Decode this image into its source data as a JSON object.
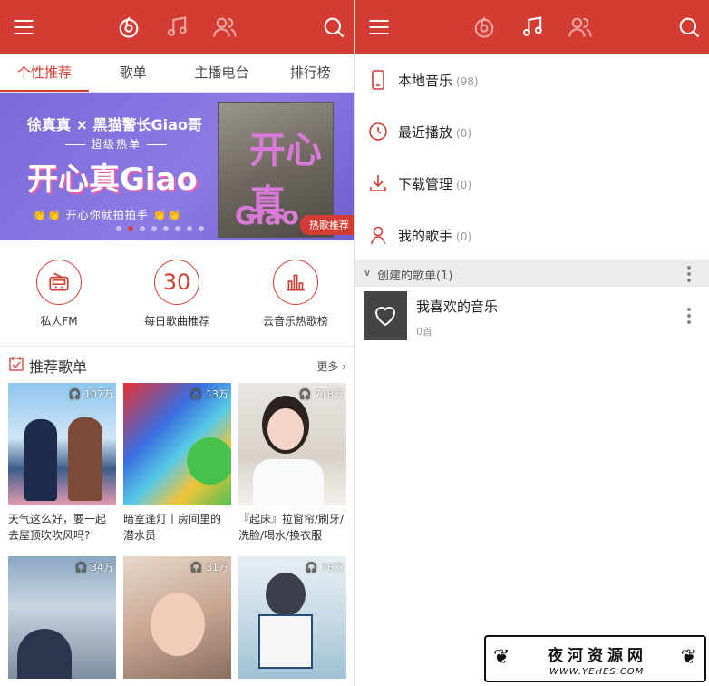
{
  "colors": {
    "accent": "#d43c33",
    "banner_bg": "#7a6ad8"
  },
  "left": {
    "topbar": {
      "icons": [
        "menu-icon",
        "discover-icon",
        "music-note-icon",
        "friends-icon",
        "search-icon"
      ]
    },
    "tabs": [
      {
        "label": "个性推荐",
        "active": true
      },
      {
        "label": "歌单"
      },
      {
        "label": "主播电台"
      },
      {
        "label": "排行榜"
      }
    ],
    "banner": {
      "line1": "徐真真 × 黑猫警长Giao哥",
      "line2": "超级热单",
      "line3": "开心真Giao",
      "line4": "👏👏 开心你就拍拍手 👏👏",
      "poster_title": "开心真",
      "poster_sub": "Giao",
      "tag": "热歌推荐",
      "dots_total": 8,
      "dots_active": 1
    },
    "circle_nav": [
      {
        "label": "私人FM",
        "icon": "radio-icon"
      },
      {
        "label": "每日歌曲推荐",
        "icon_text": "30"
      },
      {
        "label": "云音乐热歌榜",
        "icon": "chart-bars-icon"
      }
    ],
    "recommend": {
      "title": "推荐歌单",
      "more": "更多",
      "cards": [
        {
          "count": "107万",
          "caption": "天气这么好，要一起去屋顶吹吹风吗?"
        },
        {
          "count": "13万",
          "caption": "暗室逢灯丨房间里的潜水员"
        },
        {
          "count": "718万",
          "caption": "『起床』拉窗帘/刷牙/洗脸/喝水/换衣服"
        },
        {
          "count": "34万",
          "caption": ""
        },
        {
          "count": "31万",
          "caption": ""
        },
        {
          "count": "76万",
          "caption": ""
        }
      ]
    }
  },
  "right": {
    "items": [
      {
        "label": "本地音乐",
        "count": "(98)",
        "icon": "phone-icon"
      },
      {
        "label": "最近播放",
        "count": "(0)",
        "icon": "clock-icon"
      },
      {
        "label": "下载管理",
        "count": "(0)",
        "icon": "download-icon"
      },
      {
        "label": "我的歌手",
        "count": "(0)",
        "icon": "singer-icon"
      }
    ],
    "section": {
      "label": "创建的歌单(1)"
    },
    "playlist": {
      "name": "我喜欢的音乐",
      "count": "0首"
    }
  },
  "watermark": {
    "title": "夜河资源网",
    "url": "WWW.YEHES.COM"
  }
}
